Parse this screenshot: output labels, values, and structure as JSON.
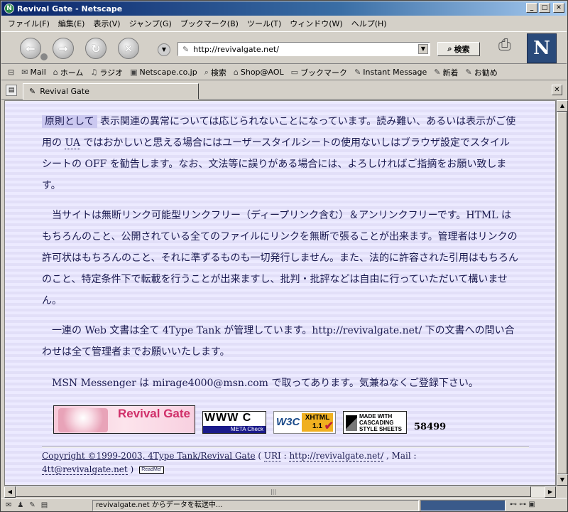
{
  "window": {
    "title": "Revival Gate - Netscape",
    "app_icon": "N",
    "controls": [
      "_",
      "□",
      "✕"
    ]
  },
  "menu": [
    "ファイル(F)",
    "編集(E)",
    "表示(V)",
    "ジャンプ(G)",
    "ブックマーク(B)",
    "ツール(T)",
    "ウィンドウ(W)",
    "ヘルプ(H)"
  ],
  "nav": {
    "url": "http://revivalgate.net/",
    "search_label": "検索",
    "logo": "N"
  },
  "personal_toolbar": [
    {
      "icon": "mail-icon",
      "glyph": "✉",
      "label": "Mail"
    },
    {
      "icon": "home-icon",
      "glyph": "⌂",
      "label": "ホーム"
    },
    {
      "icon": "radio-icon",
      "glyph": "♫",
      "label": "ラジオ"
    },
    {
      "icon": "my-icon",
      "glyph": "▣",
      "label": "Netscape.co.jp"
    },
    {
      "icon": "search-icon",
      "glyph": "⌕",
      "label": "検索"
    },
    {
      "icon": "shop-icon",
      "glyph": "⌂",
      "label": "Shop@AOL"
    },
    {
      "icon": "folder-icon",
      "glyph": "▭",
      "label": "ブックマーク"
    },
    {
      "icon": "link-icon",
      "glyph": "✎",
      "label": "Instant Message"
    },
    {
      "icon": "link-icon",
      "glyph": "✎",
      "label": "新着"
    },
    {
      "icon": "link-icon",
      "glyph": "✎",
      "label": "お勧め"
    }
  ],
  "tab": {
    "label": "Revival Gate"
  },
  "content": {
    "p1_highlight": "原則として",
    "p1_a": " 表示関連の異常については応じられないことになっています。読み難い、あるいは表示がご使用の ",
    "p1_ua": "UA",
    "p1_b": " ではおかしいと思える場合にはユーザースタイルシートの使用ないしはブラウザ設定でスタイルシートの OFF を勧告します。なお、文法等に誤りがある場合には、よろしければご指摘をお願い致します。",
    "p2": "　当サイトは無断リンク可能型リンクフリー（ディープリンク含む）＆アンリンクフリーです。HTML はもちろんのこと、公開されている全てのファイルにリンクを無断で張ることが出来ます。管理者はリンクの許可状はもちろんのこと、それに準ずるものも一切発行しません。また、法的に許容された引用はもちろんのこと、特定条件下で転載を行うことが出来ますし、批判・批評などは自由に行っていただいて構いません。",
    "p3": "　一連の Web 文書は全て 4Type Tank が管理しています。http://revivalgate.net/ 下の文書への問い合わせは全て管理者までお願いいたします。",
    "p4": "　MSN Messenger は mirage4000@msn.com で取ってあります。気兼ねなくご登録下さい。",
    "badges": {
      "revival": "Revival Gate",
      "www_top": "WWW C",
      "www_bottom": "META Check",
      "w3c": "W3C",
      "xhtml": "XHTML 1.1",
      "css": "MADE WITH CASCADING STYLE SHEETS"
    },
    "counter": "58499",
    "footer": {
      "copyright": "Copyright ©1999-2003, 4Type Tank/Revival Gate",
      "uri_label": "URI",
      "uri": "http://revivalgate.net/",
      "mail_label": "Mail",
      "mail": "4tt@revivalgate.net",
      "readme": "ReadMe!"
    }
  },
  "status": {
    "text": "revivalgate.net からデータを転送中..."
  }
}
